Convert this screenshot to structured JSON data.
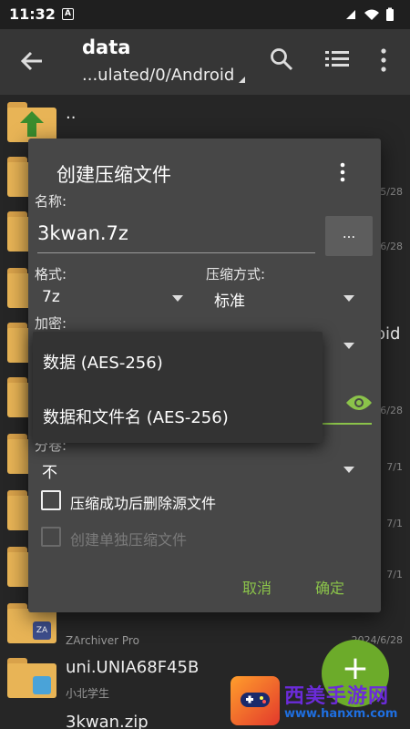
{
  "status_bar": {
    "time": "11:32",
    "notif_badge": "A"
  },
  "toolbar": {
    "title": "data",
    "path": "...ulated/0/Android"
  },
  "background_list": {
    "up_label": "..",
    "dates": [
      "5/28",
      "6/28",
      "6/28",
      "7/1",
      "7/1",
      "7/1",
      "7/1"
    ],
    "partial_text": "oid",
    "zarchiver_sub": "ZArchiver Pro",
    "zarchiver_date": "2024/6/28",
    "uni_name": "uni.UNIA68F45B",
    "uni_sub": "小北学生",
    "zip_name": "3kwan.zip"
  },
  "dialog": {
    "title": "创建压缩文件",
    "name_label": "名称:",
    "name_value": "3kwan.7z",
    "browse_label": "...",
    "format_label": "格式:",
    "format_value": "7z",
    "method_label": "压缩方式:",
    "method_value": "标准",
    "encrypt_label": "加密:",
    "split_label": "分卷:",
    "split_value": "不",
    "checkbox_delete": "压缩成功后删除源文件",
    "checkbox_separate": "创建单独压缩文件",
    "cancel": "取消",
    "ok": "确定"
  },
  "encryption_dropdown": {
    "options": [
      "数据 (AES-256)",
      "数据和文件名 (AES-256)"
    ]
  },
  "watermark": {
    "site_name": "西美手游网",
    "url": "www.hanxm.com"
  },
  "colors": {
    "accent": "#8bc34a",
    "folder": "#e8b456",
    "dialog_bg": "#474747",
    "fab": "#6cab2a"
  }
}
